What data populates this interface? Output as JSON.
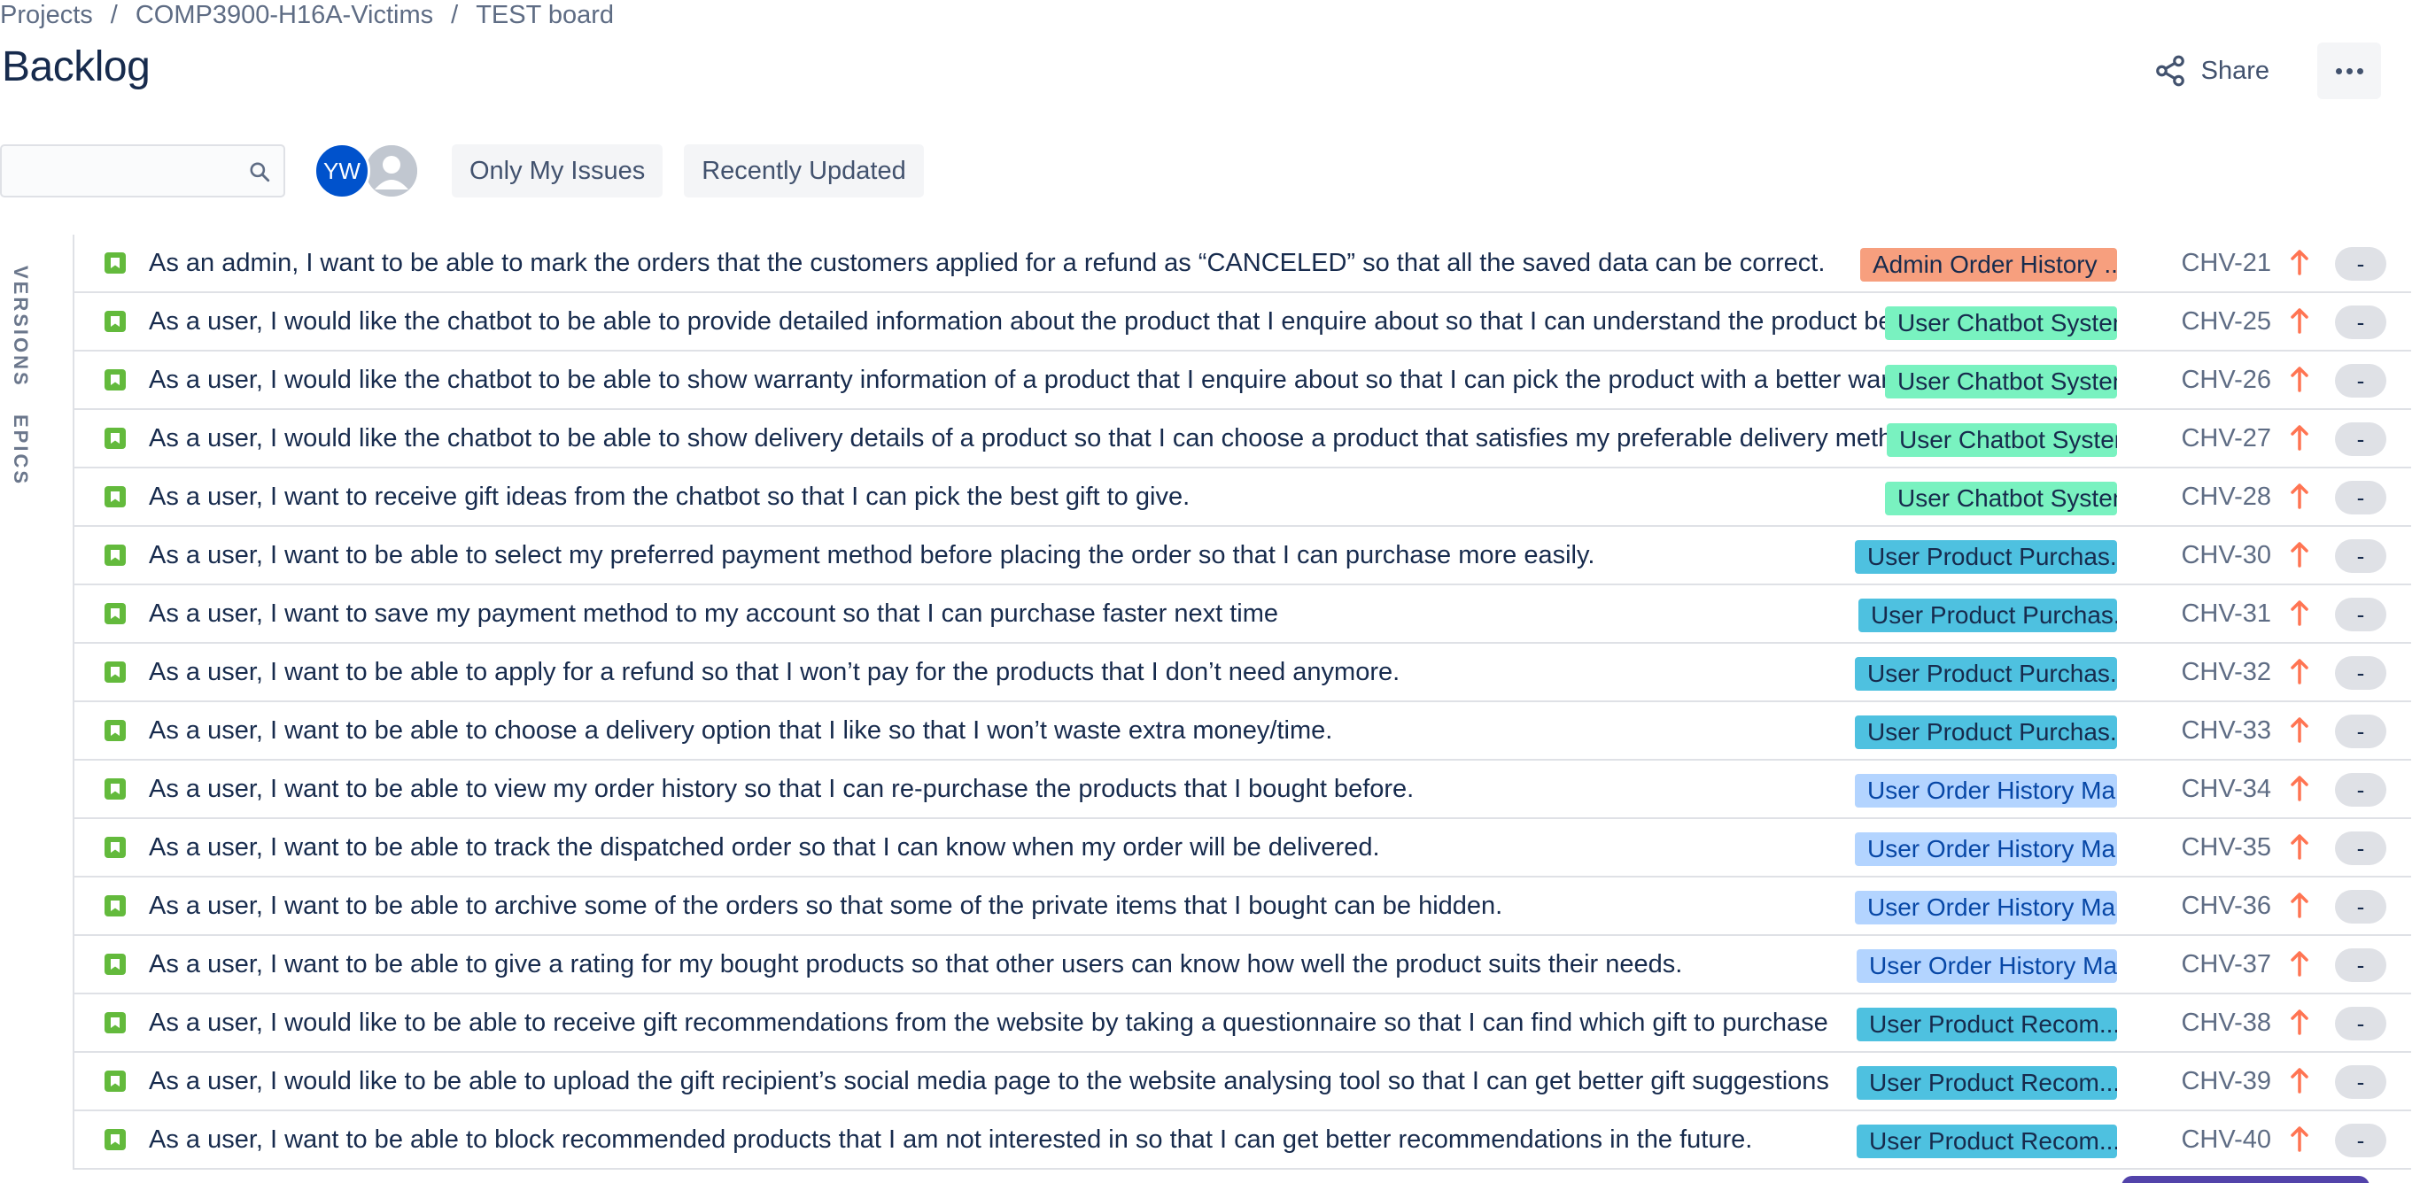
{
  "breadcrumb": {
    "items": [
      "Projects",
      "COMP3900-H16A-Victims",
      "TEST board"
    ],
    "separator": "/"
  },
  "page_title": "Backlog",
  "actions": {
    "share_label": "Share",
    "more_icon": "more-horizontal-icon"
  },
  "toolbar": {
    "search_value": "",
    "avatar_initials": "YW",
    "filter_only_my_issues": "Only My Issues",
    "filter_recently_updated": "Recently Updated"
  },
  "side_tabs": {
    "versions": "VERSIONS",
    "epics": "EPICS"
  },
  "colors": {
    "admin_order_history": "#f79f7e",
    "user_chatbot_system": "#79f2c0",
    "user_product_purchase": "#4ec1e0",
    "user_order_history": "#b3d4ff",
    "story_icon": "#63ba3c",
    "priority_high": "#ff7452"
  },
  "issues": [
    {
      "summary": "As an admin, I want to be able to mark the orders that the customers applied for a refund as “CANCELED” so that all the saved data can be correct.",
      "epic": "Admin Order History ...",
      "key": "CHV-21",
      "estimate": "-"
    },
    {
      "summary": "As a user, I would like the chatbot to be able to provide detailed information about the product that I enquire about so that I can understand the product better",
      "epic": "User Chatbot System",
      "key": "CHV-25",
      "estimate": "-"
    },
    {
      "summary": "As a user, I would like the chatbot to be able to show warranty information of a product that I enquire about so that I can pick the product with a better warranty",
      "epic": "User Chatbot System",
      "key": "CHV-26",
      "estimate": "-"
    },
    {
      "summary": "As a user, I would like the chatbot to be able to show delivery details of a product so that I can choose a product that satisfies my preferable delivery method",
      "epic": "User Chatbot System",
      "key": "CHV-27",
      "estimate": "-"
    },
    {
      "summary": "As a user, I want to receive gift ideas from the chatbot so that I can pick the best gift to give.",
      "epic": "User Chatbot System",
      "key": "CHV-28",
      "estimate": "-"
    },
    {
      "summary": "As a user, I want to be able to select my preferred payment method before placing the order so that I can purchase more easily.",
      "epic": "User Product Purchas...",
      "key": "CHV-30",
      "estimate": "-"
    },
    {
      "summary": "As a user, I want to save my payment method to my account so that I can purchase faster next time",
      "epic": "User Product Purchas...",
      "key": "CHV-31",
      "estimate": "-"
    },
    {
      "summary": "As a user, I want to be able to apply for a refund so that I won’t pay for the products that I don’t need anymore.",
      "epic": "User Product Purchas...",
      "key": "CHV-32",
      "estimate": "-"
    },
    {
      "summary": "As a user, I want to be able to choose a delivery option that I like so that I won’t waste extra money/time.",
      "epic": "User Product Purchas...",
      "key": "CHV-33",
      "estimate": "-"
    },
    {
      "summary": "As a user, I want to be able to view my order history so that I can re-purchase the products that I bought before.",
      "epic": "User Order History Ma...",
      "key": "CHV-34",
      "estimate": "-"
    },
    {
      "summary": "As a user, I want to be able to track the dispatched order so that I can know when my order will be delivered.",
      "epic": "User Order History Ma...",
      "key": "CHV-35",
      "estimate": "-"
    },
    {
      "summary": "As a user, I want to be able to archive some of the orders so that some of the private items that I bought can be hidden.",
      "epic": "User Order History Ma...",
      "key": "CHV-36",
      "estimate": "-"
    },
    {
      "summary": "As a user, I want to be able to give a rating for my bought products so that other users can know how well the product suits their needs.",
      "epic": "User Order History Ma...",
      "key": "CHV-37",
      "estimate": "-"
    },
    {
      "summary": "As a user, I would like to be able to receive gift recommendations from the website by taking a questionnaire so that I can find which gift to purchase",
      "epic": "User Product Recom...",
      "key": "CHV-38",
      "estimate": "-"
    },
    {
      "summary": "As a user, I would like to be able to upload the gift recipient’s social media page to the website analysing tool so that I can get better gift suggestions",
      "epic": "User Product Recom...",
      "key": "CHV-39",
      "estimate": "-"
    },
    {
      "summary": "As a user, I want to be able to block recommended products that I am not interested in so that I can get better recommendations in the future.",
      "epic": "User Product Recom...",
      "key": "CHV-40",
      "estimate": "-"
    }
  ]
}
